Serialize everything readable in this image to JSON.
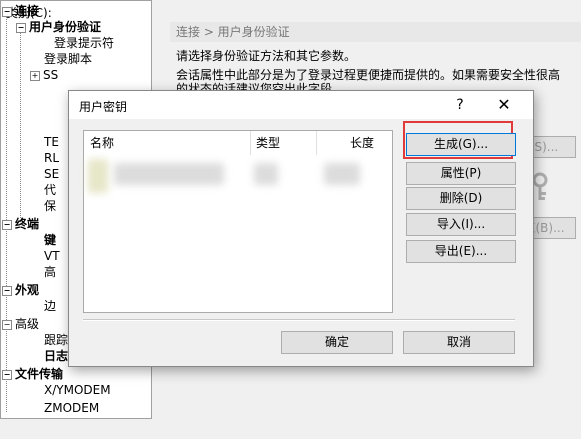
{
  "category_label": "类别(C):",
  "tree": [
    {
      "label": "连接",
      "bold": true
    },
    {
      "label": "用户身份验证",
      "bold": true
    },
    {
      "label": "登录提示符",
      "bold": false
    },
    {
      "label": "登录脚本",
      "bold": false
    },
    {
      "label": "SS",
      "bold": false
    },
    {
      "label": "TE",
      "bold": false
    },
    {
      "label": "RL",
      "bold": false
    },
    {
      "label": "SE",
      "bold": false
    },
    {
      "label": "代",
      "bold": false
    },
    {
      "label": "保",
      "bold": false
    },
    {
      "label": "终端",
      "bold": true
    },
    {
      "label": "键",
      "bold": true
    },
    {
      "label": "VT",
      "bold": false
    },
    {
      "label": "高",
      "bold": false
    },
    {
      "label": "外观",
      "bold": true
    },
    {
      "label": "边",
      "bold": false
    },
    {
      "label": "高级",
      "bold": false
    },
    {
      "label": "跟踪",
      "bold": false
    },
    {
      "label": "日志记录",
      "bold": true
    },
    {
      "label": "文件传输",
      "bold": true
    },
    {
      "label": "X/YMODEM",
      "bold": false
    },
    {
      "label": "ZMODEM",
      "bold": false
    }
  ],
  "right_header": "连接 > 用户身份验证",
  "desc_line1": "请选择身份验证方法和其它参数。",
  "desc_line2": "会话属性中此部分是为了登录过程更便捷而提供的。如果需要安全性很高",
  "desc_line3": "的状态的话建议您空出此字段。",
  "bg_buttons": {
    "setup": "(S)...",
    "browse": "览(B)..."
  },
  "dialog": {
    "title": "用户密钥",
    "help": "?",
    "close": "✕",
    "columns": {
      "name": "名称",
      "type": "类型",
      "length": "长度"
    },
    "buttons": {
      "generate": "生成(G)...",
      "properties": "属性(P)",
      "delete": "删除(D)",
      "import": "导入(I)...",
      "export": "导出(E)..."
    },
    "ok": "确定",
    "cancel": "取消"
  }
}
